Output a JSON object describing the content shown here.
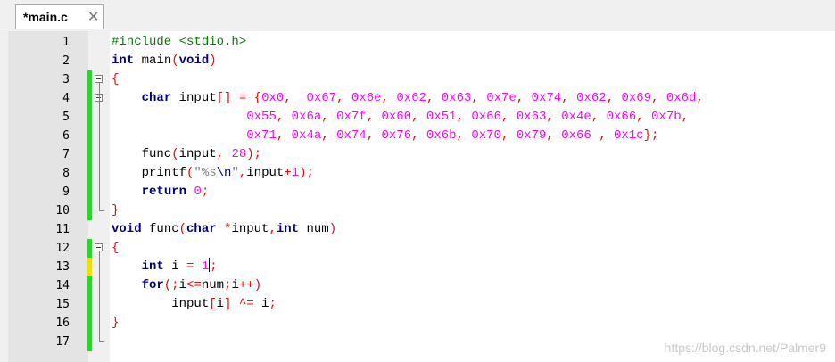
{
  "tab": {
    "title": "*main.c",
    "close_glyph": "✕"
  },
  "watermark": "https://blog.csdn.net/Palmer9",
  "colors": {
    "change_saved": "#29d629",
    "change_unsaved": "#f0e000"
  },
  "lines": [
    {
      "n": "1",
      "mark": "",
      "tokens": [
        [
          "pp",
          "#include <stdio.h>"
        ]
      ]
    },
    {
      "n": "2",
      "mark": "",
      "tokens": [
        [
          "kw",
          "int"
        ],
        [
          "pl",
          " main"
        ],
        [
          "op",
          "("
        ],
        [
          "kw",
          "void"
        ],
        [
          "op",
          ")"
        ]
      ]
    },
    {
      "n": "3",
      "mark": "green",
      "tokens": [
        [
          "op",
          "{"
        ]
      ]
    },
    {
      "n": "4",
      "mark": "green",
      "tokens": [
        [
          "pl",
          "    "
        ],
        [
          "kw",
          "char"
        ],
        [
          "pl",
          " input"
        ],
        [
          "op",
          "[] = {"
        ],
        [
          "num",
          "0x0"
        ],
        [
          "op",
          ",  "
        ],
        [
          "num",
          "0x67"
        ],
        [
          "op",
          ", "
        ],
        [
          "num",
          "0x6e"
        ],
        [
          "op",
          ", "
        ],
        [
          "num",
          "0x62"
        ],
        [
          "op",
          ", "
        ],
        [
          "num",
          "0x63"
        ],
        [
          "op",
          ", "
        ],
        [
          "num",
          "0x7e"
        ],
        [
          "op",
          ", "
        ],
        [
          "num",
          "0x74"
        ],
        [
          "op",
          ", "
        ],
        [
          "num",
          "0x62"
        ],
        [
          "op",
          ", "
        ],
        [
          "num",
          "0x69"
        ],
        [
          "op",
          ", "
        ],
        [
          "num",
          "0x6d"
        ],
        [
          "op",
          ","
        ]
      ]
    },
    {
      "n": "5",
      "mark": "green",
      "tokens": [
        [
          "pl",
          "                  "
        ],
        [
          "num",
          "0x55"
        ],
        [
          "op",
          ", "
        ],
        [
          "num",
          "0x6a"
        ],
        [
          "op",
          ", "
        ],
        [
          "num",
          "0x7f"
        ],
        [
          "op",
          ", "
        ],
        [
          "num",
          "0x60"
        ],
        [
          "op",
          ", "
        ],
        [
          "num",
          "0x51"
        ],
        [
          "op",
          ", "
        ],
        [
          "num",
          "0x66"
        ],
        [
          "op",
          ", "
        ],
        [
          "num",
          "0x63"
        ],
        [
          "op",
          ", "
        ],
        [
          "num",
          "0x4e"
        ],
        [
          "op",
          ", "
        ],
        [
          "num",
          "0x66"
        ],
        [
          "op",
          ", "
        ],
        [
          "num",
          "0x7b"
        ],
        [
          "op",
          ","
        ]
      ]
    },
    {
      "n": "6",
      "mark": "green",
      "tokens": [
        [
          "pl",
          "                  "
        ],
        [
          "num",
          "0x71"
        ],
        [
          "op",
          ", "
        ],
        [
          "num",
          "0x4a"
        ],
        [
          "op",
          ", "
        ],
        [
          "num",
          "0x74"
        ],
        [
          "op",
          ", "
        ],
        [
          "num",
          "0x76"
        ],
        [
          "op",
          ", "
        ],
        [
          "num",
          "0x6b"
        ],
        [
          "op",
          ", "
        ],
        [
          "num",
          "0x70"
        ],
        [
          "op",
          ", "
        ],
        [
          "num",
          "0x79"
        ],
        [
          "op",
          ", "
        ],
        [
          "num",
          "0x66"
        ],
        [
          "op",
          " , "
        ],
        [
          "num",
          "0x1c"
        ],
        [
          "op",
          "};"
        ]
      ]
    },
    {
      "n": "7",
      "mark": "green",
      "tokens": [
        [
          "pl",
          "    func"
        ],
        [
          "op",
          "("
        ],
        [
          "pl",
          "input"
        ],
        [
          "op",
          ", "
        ],
        [
          "num",
          "28"
        ],
        [
          "op",
          ");"
        ]
      ]
    },
    {
      "n": "8",
      "mark": "green",
      "tokens": [
        [
          "pl",
          "    printf"
        ],
        [
          "op",
          "("
        ],
        [
          "str",
          "\"%s"
        ],
        [
          "esc",
          "\\n"
        ],
        [
          "str",
          "\""
        ],
        [
          "op",
          ","
        ],
        [
          "pl",
          "input"
        ],
        [
          "op",
          "+"
        ],
        [
          "num",
          "1"
        ],
        [
          "op",
          ");"
        ]
      ]
    },
    {
      "n": "9",
      "mark": "green",
      "tokens": [
        [
          "pl",
          "    "
        ],
        [
          "kw",
          "return"
        ],
        [
          "pl",
          " "
        ],
        [
          "num",
          "0"
        ],
        [
          "op",
          ";"
        ]
      ]
    },
    {
      "n": "10",
      "mark": "green",
      "tokens": [
        [
          "op",
          "}"
        ]
      ]
    },
    {
      "n": "11",
      "mark": "",
      "tokens": [
        [
          "kw",
          "void"
        ],
        [
          "pl",
          " func"
        ],
        [
          "op",
          "("
        ],
        [
          "kw",
          "char"
        ],
        [
          "pl",
          " "
        ],
        [
          "op",
          "*"
        ],
        [
          "pl",
          "input"
        ],
        [
          "op",
          ","
        ],
        [
          "kw",
          "int"
        ],
        [
          "pl",
          " num"
        ],
        [
          "op",
          ")"
        ]
      ]
    },
    {
      "n": "12",
      "mark": "green",
      "tokens": [
        [
          "op",
          "{"
        ]
      ]
    },
    {
      "n": "13",
      "mark": "yellow",
      "tokens": [
        [
          "pl",
          "    "
        ],
        [
          "kw",
          "int"
        ],
        [
          "pl",
          " i "
        ],
        [
          "op",
          "= "
        ],
        [
          "num",
          "1"
        ],
        [
          "caret",
          ""
        ],
        [
          "op",
          ";"
        ]
      ]
    },
    {
      "n": "14",
      "mark": "green",
      "tokens": [
        [
          "pl",
          "    "
        ],
        [
          "kw",
          "for"
        ],
        [
          "op",
          "(;"
        ],
        [
          "pl",
          "i"
        ],
        [
          "op",
          "<="
        ],
        [
          "pl",
          "num"
        ],
        [
          "op",
          ";"
        ],
        [
          "pl",
          "i"
        ],
        [
          "op",
          "++)"
        ]
      ]
    },
    {
      "n": "15",
      "mark": "green",
      "tokens": [
        [
          "pl",
          "        input"
        ],
        [
          "op",
          "["
        ],
        [
          "pl",
          "i"
        ],
        [
          "op",
          "] ^="
        ],
        [
          "pl",
          " i"
        ],
        [
          "op",
          ";"
        ]
      ]
    },
    {
      "n": "16",
      "mark": "green",
      "tokens": [
        [
          "op",
          "}"
        ]
      ]
    },
    {
      "n": "17",
      "mark": "green",
      "tokens": []
    }
  ]
}
